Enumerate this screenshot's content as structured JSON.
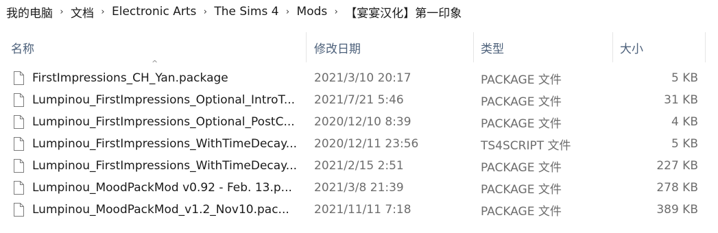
{
  "breadcrumb": {
    "items": [
      "我的电脑",
      "文档",
      "Electronic Arts",
      "The Sims 4",
      "Mods",
      "【宴宴汉化】第一印象"
    ],
    "separator": "›"
  },
  "columns": {
    "name": "名称",
    "date": "修改日期",
    "type": "类型",
    "size": "大小",
    "sort_indicator": "^"
  },
  "files": [
    {
      "name": "FirstImpressions_CH_Yan.package",
      "date": "2021/3/10 20:17",
      "type": "PACKAGE 文件",
      "size": "5 KB"
    },
    {
      "name": "Lumpinou_FirstImpressions_Optional_IntroT...",
      "date": "2021/7/21 5:46",
      "type": "PACKAGE 文件",
      "size": "31 KB"
    },
    {
      "name": "Lumpinou_FirstImpressions_Optional_PostC...",
      "date": "2020/12/10 8:39",
      "type": "PACKAGE 文件",
      "size": "4 KB"
    },
    {
      "name": "Lumpinou_FirstImpressions_WithTimeDecay...",
      "date": "2020/12/11 23:56",
      "type": "TS4SCRIPT 文件",
      "size": "5 KB"
    },
    {
      "name": "Lumpinou_FirstImpressions_WithTimeDecay...",
      "date": "2021/2/15 2:51",
      "type": "PACKAGE 文件",
      "size": "227 KB"
    },
    {
      "name": "Lumpinou_MoodPackMod v0.92 - Feb. 13.p...",
      "date": "2021/3/8 21:39",
      "type": "PACKAGE 文件",
      "size": "278 KB"
    },
    {
      "name": "Lumpinou_MoodPackMod_v1.2_Nov10.pac...",
      "date": "2021/11/11 7:18",
      "type": "PACKAGE 文件",
      "size": "389 KB"
    }
  ],
  "icons": {
    "file": "file-icon",
    "separator": "chevron-right-icon"
  }
}
